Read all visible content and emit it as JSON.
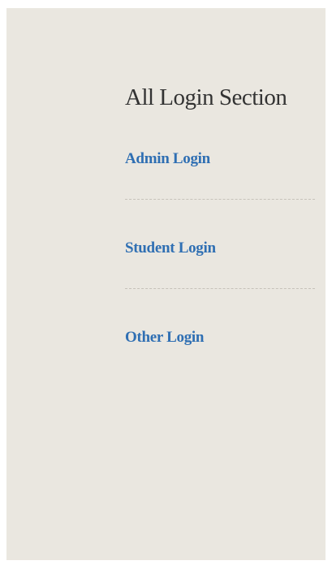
{
  "login_section": {
    "title": "All Login Section",
    "links": [
      {
        "label": "Admin Login"
      },
      {
        "label": "Student Login"
      },
      {
        "label": "Other Login"
      }
    ]
  },
  "colors": {
    "panel_background": "#eae7e0",
    "link": "#2f6fb3",
    "title": "#333333",
    "divider": "#c6c2ba"
  }
}
